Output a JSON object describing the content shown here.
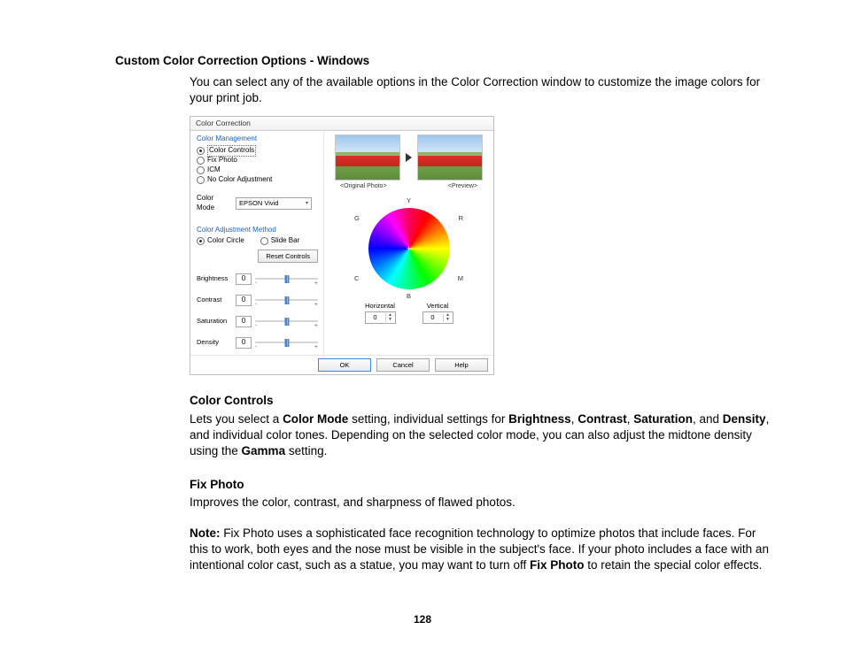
{
  "heading": "Custom Color Correction Options - Windows",
  "intro": "You can select any of the available options in the Color Correction window to customize the image colors for your print job.",
  "cc_heading": "Color Controls",
  "cc_pre": "Lets you select a ",
  "cc_b1": "Color Mode",
  "cc_mid1": " setting, individual settings for ",
  "cc_b2": "Brightness",
  "cc_sep": ", ",
  "cc_b3": "Contrast",
  "cc_b4": "Saturation",
  "cc_mid2": ", and ",
  "cc_b5": "Density",
  "cc_mid3": ", and individual color tones. Depending on the selected color mode, you can also adjust the midtone density using the ",
  "cc_b6": "Gamma",
  "cc_end": " setting.",
  "fp_heading": "Fix Photo",
  "fp_body": "Improves the color, contrast, and sharpness of flawed photos.",
  "note_b": "Note:",
  "note_1": " Fix Photo uses a sophisticated face recognition technology to optimize photos that include faces. For this to work, both eyes and the nose must be visible in the subject's face. If your photo includes a face with an intentional color cast, such as a statue, you may want to turn off ",
  "note_bfix": "Fix Photo",
  "note_2": " to retain the special color effects.",
  "page_number": "128",
  "dlg": {
    "title": "Color Correction",
    "grp_mgmt": "Color Management",
    "radios": {
      "r1": "Color Controls",
      "r2": "Fix Photo",
      "r3": "ICM",
      "r4": "No Color Adjustment"
    },
    "color_mode_label": "Color Mode",
    "color_mode_value": "EPSON Vivid",
    "grp_method": "Color Adjustment Method",
    "method": {
      "circle": "Color Circle",
      "slide": "Slide Bar"
    },
    "reset": "Reset Controls",
    "sliders": {
      "brightness": "Brightness",
      "contrast": "Contrast",
      "saturation": "Saturation",
      "density": "Density",
      "value": "0"
    },
    "orig": "<Original Photo>",
    "prev": "<Preview>",
    "axes": {
      "y": "Y",
      "r": "R",
      "g": "G",
      "m": "M",
      "c": "C",
      "b": "B"
    },
    "hv": {
      "h": "Horizontal",
      "v": "Vertical",
      "val": "0"
    },
    "ok": "OK",
    "cancel": "Cancel",
    "help": "Help"
  }
}
